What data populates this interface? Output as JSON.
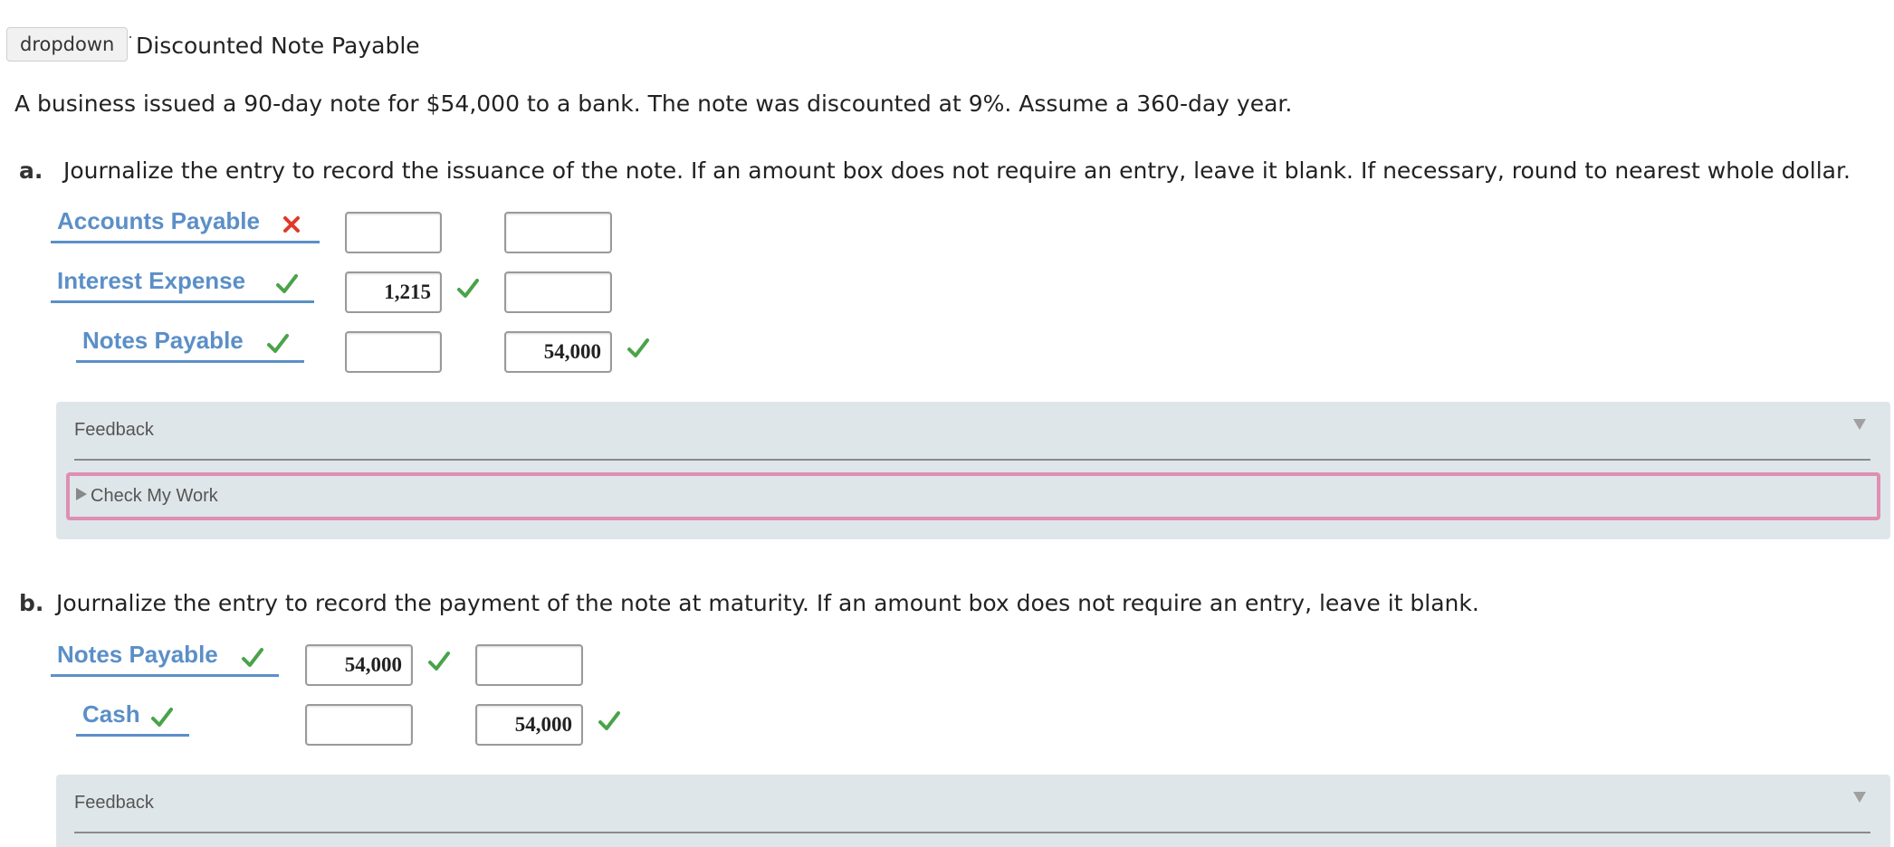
{
  "header": {
    "dropdown_label": "dropdown",
    "title": "Discounted Note Payable"
  },
  "intro": "A business issued a 90-day note for $54,000 to a bank. The note was discounted at 9%. Assume a 360-day year.",
  "part_a": {
    "letter": "a.",
    "instructions": "Journalize the entry to record the issuance of the note. If an amount box does not require an entry, leave it blank. If necessary, round to nearest whole dollar.",
    "rows": [
      {
        "account": "Accounts Payable",
        "account_status": "incorrect",
        "debit": "",
        "credit": ""
      },
      {
        "account": "Interest Expense",
        "account_status": "correct",
        "debit": "1,215",
        "debit_status": "correct",
        "credit": ""
      },
      {
        "account": "Notes Payable",
        "account_status": "correct",
        "debit": "",
        "credit": "54,000",
        "credit_status": "correct"
      }
    ],
    "feedback_label": "Feedback",
    "check_my_work_label": "Check My Work"
  },
  "part_b": {
    "letter": "b.",
    "instructions": "Journalize the entry to record the payment of the note at maturity. If an amount box does not require an entry, leave it blank.",
    "rows": [
      {
        "account": "Notes Payable",
        "account_status": "correct",
        "debit": "54,000",
        "debit_status": "correct",
        "credit": ""
      },
      {
        "account": "Cash",
        "account_status": "correct",
        "debit": "",
        "credit": "54,000",
        "credit_status": "correct"
      }
    ],
    "feedback_label": "Feedback"
  },
  "colors": {
    "account_blue": "#5b8fc7",
    "correct_green": "#4aa34a",
    "incorrect_red": "#e0392b",
    "feedback_bg": "#dfe6ea",
    "check_border_pink": "#de8fb3"
  },
  "icons": {
    "correct": "check-icon",
    "incorrect": "x-icon",
    "expand": "triangle-down-icon",
    "collapsed": "triangle-right-icon"
  }
}
